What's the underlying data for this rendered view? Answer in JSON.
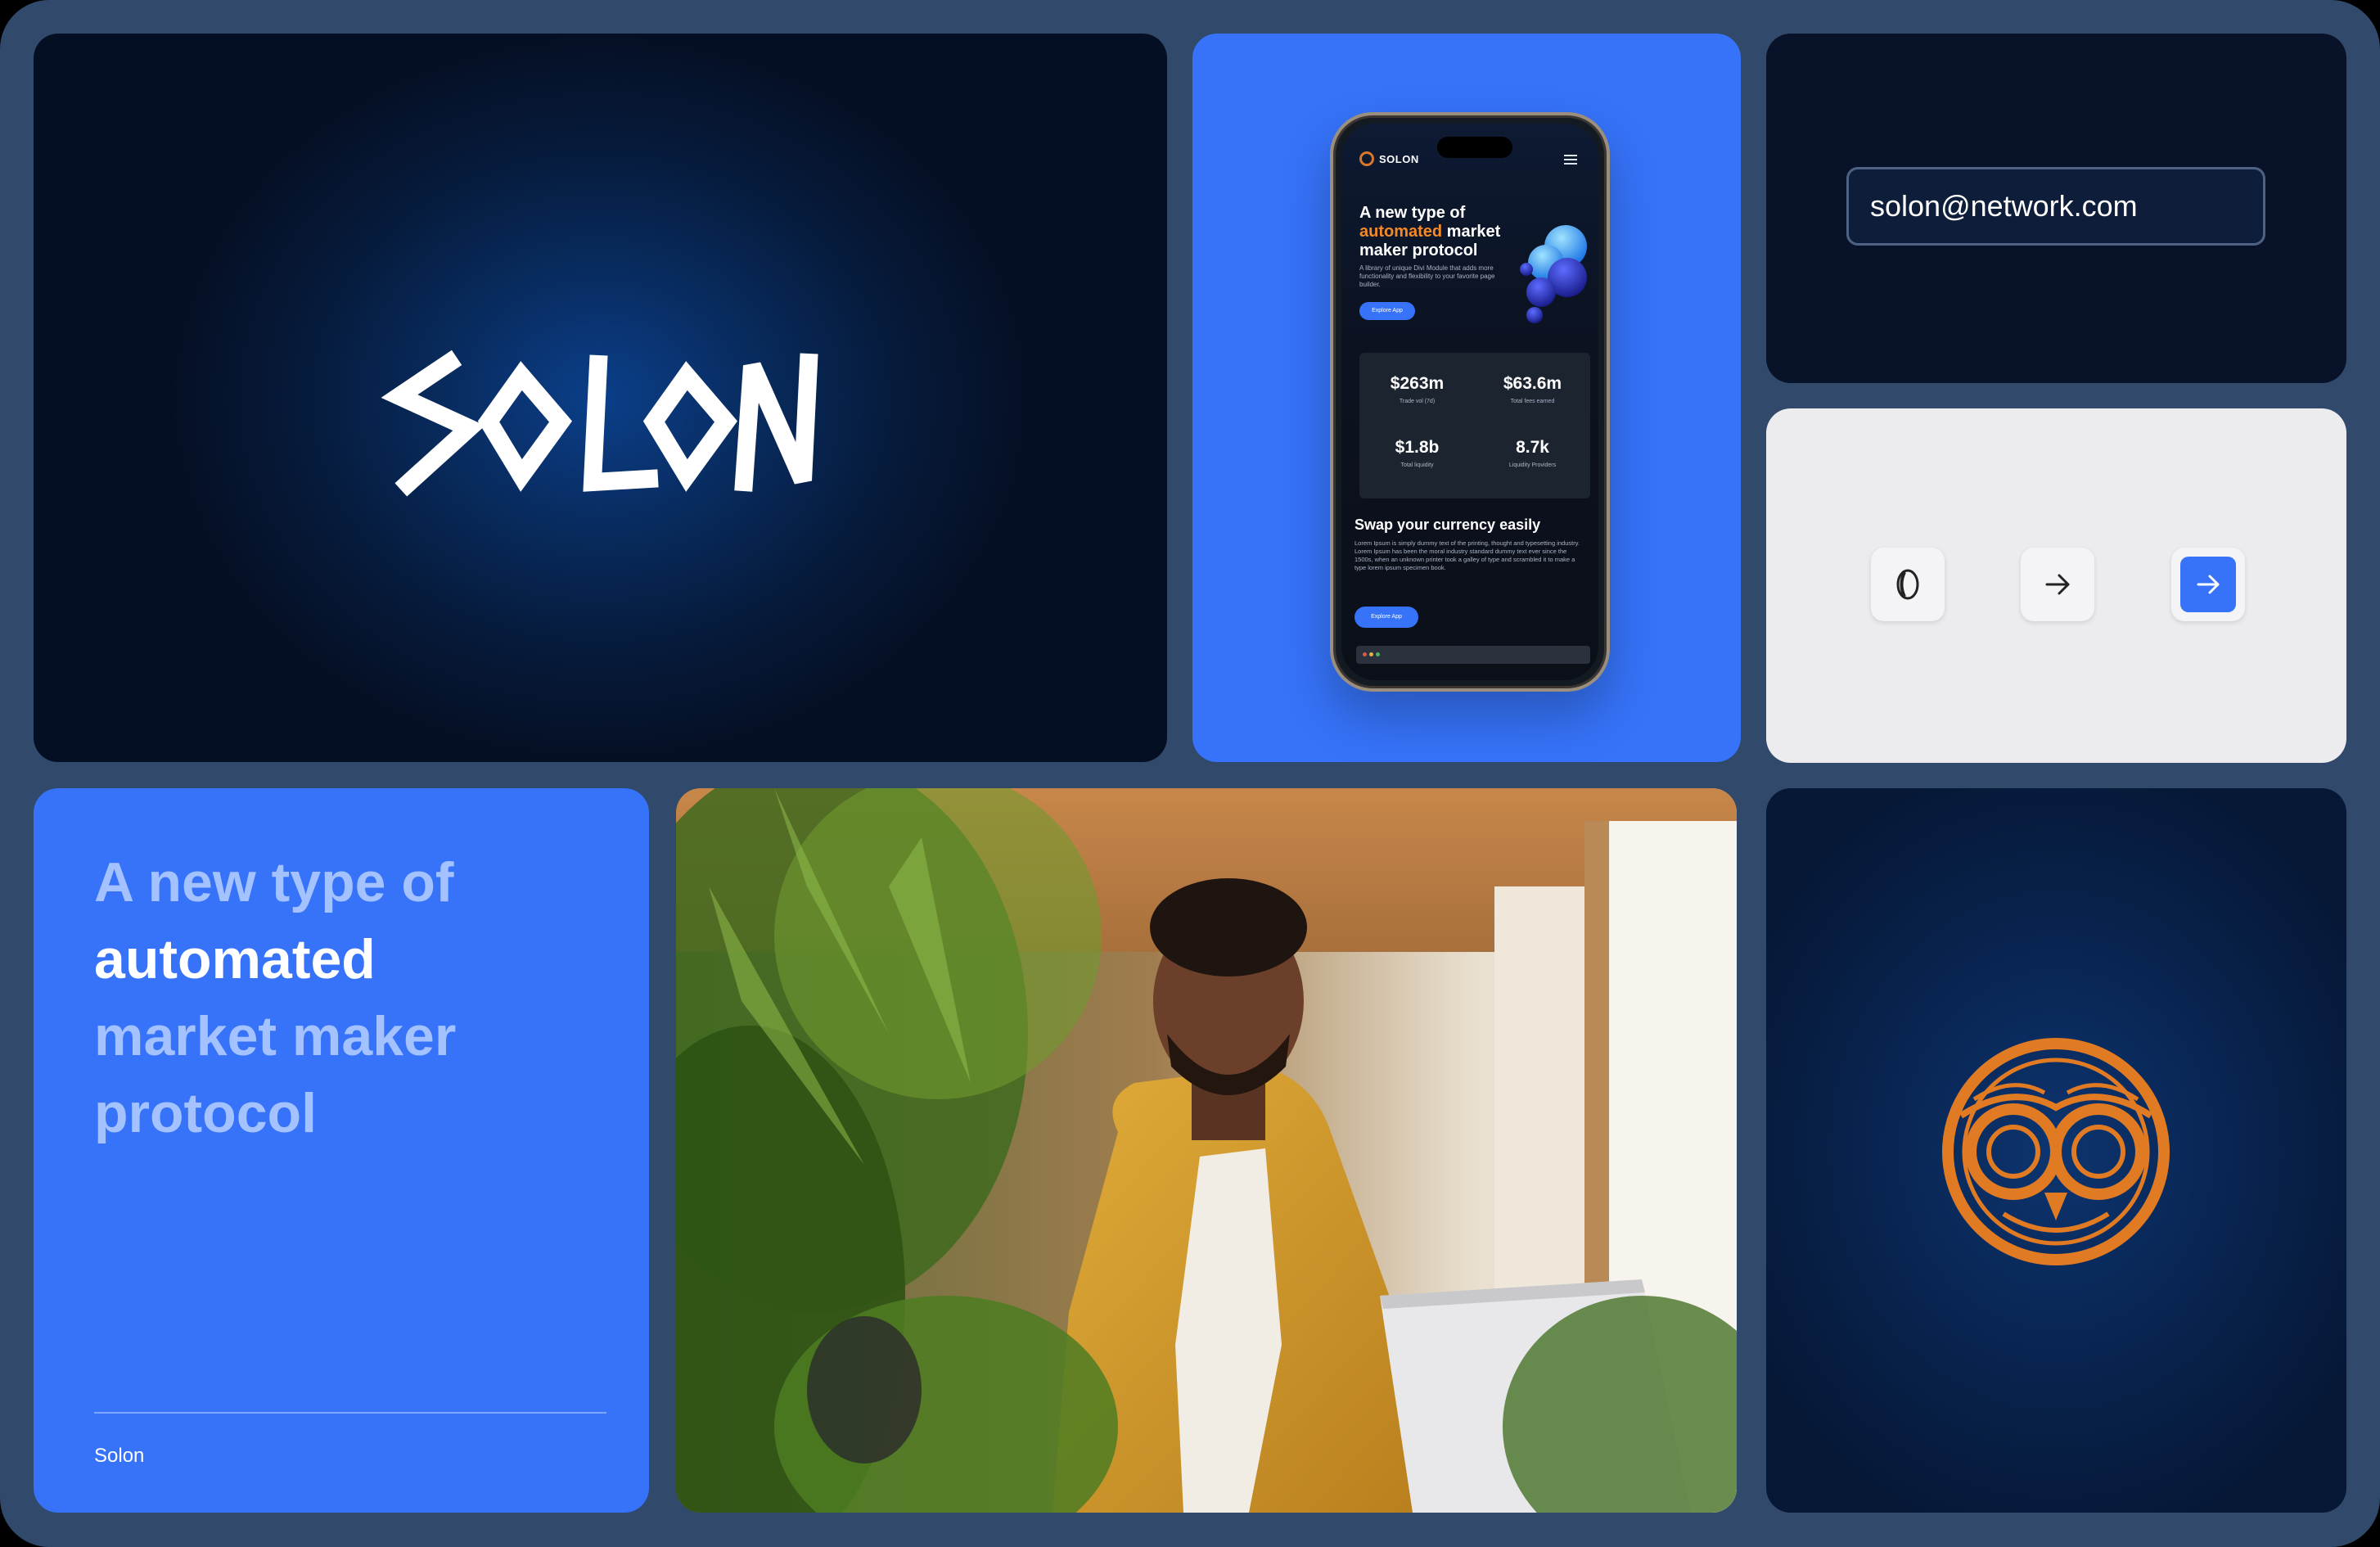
{
  "logo_tile": {
    "brand_wordmark": "SOLON"
  },
  "phone": {
    "nav": {
      "brand": "SOLON"
    },
    "hero": {
      "line1": "A new type of",
      "accent": "automated",
      "line2_rest": " market",
      "line3": "maker protocol",
      "description": "A library of unique Divi Module that adds more functionality and flexibility to your favorite page builder.",
      "cta": "Explore App"
    },
    "stats": [
      {
        "value": "$263m",
        "label": "Trade vol (7d)"
      },
      {
        "value": "$63.6m",
        "label": "Total fees earned"
      },
      {
        "value": "$1.8b",
        "label": "Total liquidity"
      },
      {
        "value": "8.7k",
        "label": "Liquidity Providers"
      }
    ],
    "swap": {
      "title": "Swap your currency easily",
      "text": "Lorem Ipsum is simply dummy text of the printing, thought and typesetting industry. Lorem Ipsum has been the moral industry standard dummy text ever since the 1500s, when an unknown printer took a galley of type and scrambled it to make a type lorem ipsum specimen book.",
      "cta": "Explore App"
    }
  },
  "email_tile": {
    "email_value": "solon@network.com"
  },
  "buttons_tile": {
    "icons": [
      "loader-icon",
      "arrow-right-icon",
      "arrow-right-icon"
    ]
  },
  "headline_tile": {
    "line1": "A new type of",
    "line2": "automated",
    "line3": "market maker",
    "line4": "protocol",
    "footer": "Solon"
  },
  "colors": {
    "brand_blue": "#3673f9",
    "accent_orange": "#e07b24",
    "deep_navy": "#081329",
    "frame": "#31496b"
  }
}
